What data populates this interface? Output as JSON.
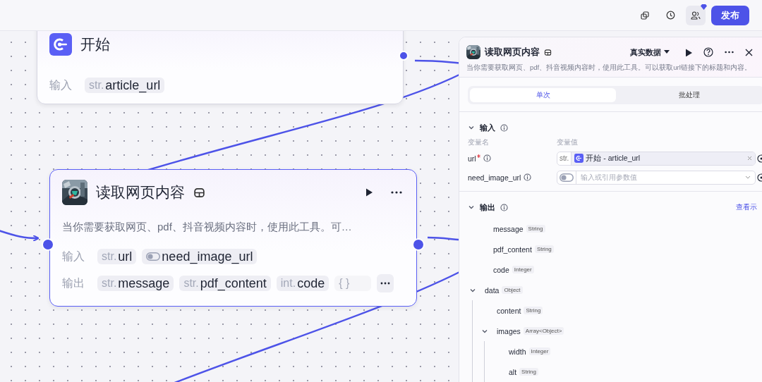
{
  "topbar": {
    "publish": "发布",
    "members_badge": true
  },
  "canvas": {
    "nodes": [
      {
        "kind": "start",
        "title": "开始",
        "rows": [
          {
            "label": "输入",
            "params": [
              {
                "kind": "str",
                "type": "str.",
                "name": "article_url"
              }
            ]
          }
        ]
      },
      {
        "kind": "tool",
        "title": "读取网页内容",
        "description": "当你需要获取网页、pdf、抖音视频内容时，使用此工具。可…",
        "selected": true,
        "rows": [
          {
            "label": "输入",
            "params": [
              {
                "kind": "str",
                "type": "str.",
                "name": "url"
              },
              {
                "kind": "boolean",
                "name": "need_image_url"
              }
            ]
          },
          {
            "label": "输出",
            "params": [
              {
                "kind": "str",
                "type": "str.",
                "name": "message"
              },
              {
                "kind": "str",
                "type": "str.",
                "name": "pdf_content"
              },
              {
                "kind": "int",
                "type": "int.",
                "name": "code"
              },
              {
                "kind": "object",
                "type": "{ }"
              }
            ],
            "more": true
          }
        ]
      }
    ]
  },
  "panel": {
    "title": "读取网页内容",
    "mode": "真实数据",
    "description": "当你需要获取网页、pdf、抖音视频内容时，使用此工具。可以获取url链接下的标题和内容。",
    "tabs": [
      {
        "label": "单次",
        "selected": true
      },
      {
        "label": "批处理",
        "selected": false
      }
    ],
    "input": {
      "title": "输入",
      "expanded": true,
      "columns": [
        "变量名",
        "变量值"
      ],
      "rows": [
        {
          "name": "url",
          "required": true,
          "kind": "ref",
          "type": "str.",
          "value": "开始 - article_url"
        },
        {
          "name": "need_image_url",
          "required": false,
          "kind": "boolean",
          "placeholder": "输入或引用参数值"
        }
      ]
    },
    "output": {
      "title": "输出",
      "expanded": true,
      "link": "查看示",
      "tree": [
        {
          "name": "message",
          "type": "String"
        },
        {
          "name": "pdf_content",
          "type": "String"
        },
        {
          "name": "code",
          "type": "Integer"
        },
        {
          "name": "data",
          "type": "Object",
          "expanded": true,
          "children": [
            {
              "name": "content",
              "type": "String"
            },
            {
              "name": "images",
              "type": "Array<Object>",
              "expanded": true,
              "children": [
                {
                  "name": "width",
                  "type": "Integer"
                },
                {
                  "name": "alt",
                  "type": "String"
                }
              ]
            }
          ]
        }
      ]
    }
  }
}
